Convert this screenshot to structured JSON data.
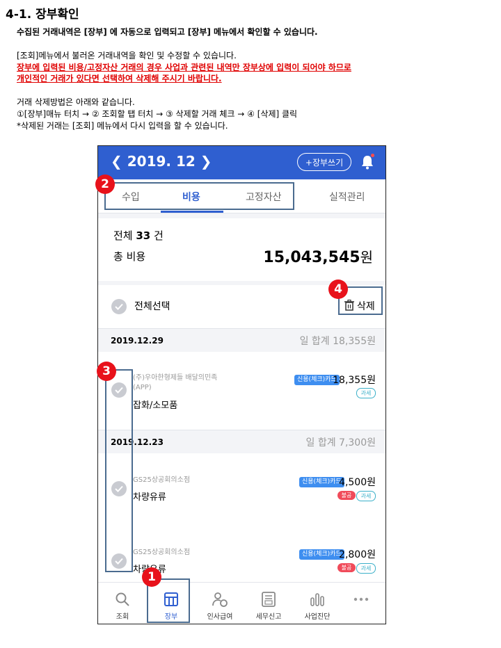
{
  "doc": {
    "title": "4-1. 장부확인",
    "line1": "수집된 거래내역은 [장부] 에 자동으로 입력되고 [장부] 메뉴에서 확인할 수 있습니다.",
    "line2": "[조회]메뉴에서 불러온 거래내역을 확인 및 수정할 수 있습니다.",
    "line3": "장부에 입력된 비용/고정자산 거래의 경우 사업과 관련된 내역만 장부상에 입력이 되어야 하므로",
    "line4": "개인적인 거래가 있다면 선택하여 삭제해 주시기 바랍니다.",
    "line5": "거래 삭제방법은 아래와 같습니다.",
    "line6": "①[장부]매뉴  터치 → ② 조회할 탭 터치 → ③ 삭제할 거래 체크 → ④ [삭제]  클릭",
    "line7": " *삭제된 거래는 [조회] 메뉴에서 다시 입력을 할 수 있습니다."
  },
  "app": {
    "month": "2019. 12",
    "write_button": "+장부쓰기",
    "colors": {
      "primary": "#2f5fd0",
      "annot": "#e8121b"
    },
    "tabs": [
      {
        "label": "수입"
      },
      {
        "label": "비용"
      },
      {
        "label": "고정자산"
      },
      {
        "label": "실적관리"
      }
    ],
    "active_tab": "비용",
    "summary": {
      "count_prefix": "전체 ",
      "count": "33",
      "count_suffix": " 건",
      "total_label": "총 비용",
      "total_amount": "15,043,545",
      "won": "원"
    },
    "select_all": "전체선택",
    "delete": "삭제",
    "groups": [
      {
        "date": "2019.12.29",
        "total": "일 합계 18,355원",
        "items": [
          {
            "merchant_l1": "(주)우아한형제들 배달의민족",
            "merchant_l2": "(APP)",
            "category": "잡화/소모품",
            "card": "신용(체크)카드",
            "amount": "18,355원",
            "tax": "과세"
          }
        ]
      },
      {
        "date": "2019.12.23",
        "total": "일 합계 7,300원",
        "items": [
          {
            "merchant_l1": "GS25상공회의소점",
            "category": "차량유류",
            "card": "신용(체크)카드",
            "amount": "4,500원",
            "nondeduct": "불공",
            "tax": "과세"
          },
          {
            "merchant_l1": "GS25상공회의소점",
            "category": "차량유류",
            "card": "신용(체크)카드",
            "amount": "2,800원",
            "nondeduct": "불공",
            "tax": "과세"
          }
        ]
      }
    ],
    "nav": [
      {
        "label": "조회",
        "icon": "search-icon"
      },
      {
        "label": "장부",
        "icon": "ledger-icon"
      },
      {
        "label": "인사급여",
        "icon": "payroll-icon"
      },
      {
        "label": "세무신고",
        "icon": "tax-icon"
      },
      {
        "label": "사업진단",
        "icon": "chart-icon"
      },
      {
        "label": "",
        "icon": "more-icon"
      }
    ],
    "badges": [
      "1",
      "2",
      "3",
      "4"
    ]
  }
}
